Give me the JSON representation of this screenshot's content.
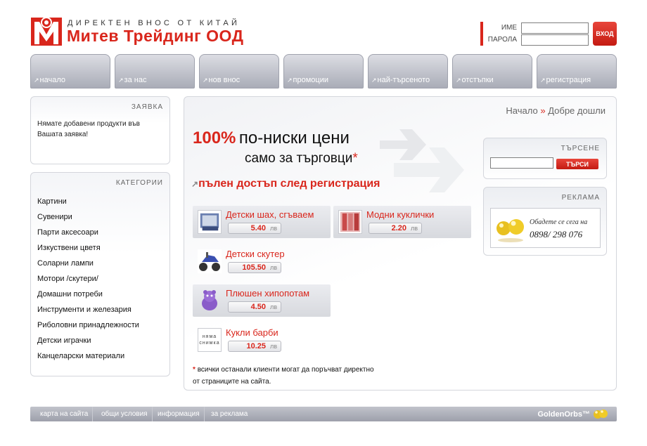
{
  "header": {
    "tagline": "ДИРЕКТЕН ВНОС ОТ КИТАЙ",
    "company": "Митев Трейдинг ООД"
  },
  "login": {
    "name_label": "ИМЕ",
    "password_label": "ПАРОЛА",
    "name_value": "",
    "password_value": "",
    "submit_label": "ВХОД"
  },
  "nav": {
    "items": [
      {
        "label": "начало"
      },
      {
        "label": "за нас"
      },
      {
        "label": "нов внос"
      },
      {
        "label": "промоции"
      },
      {
        "label": "най-търсеното"
      },
      {
        "label": "отстъпки"
      },
      {
        "label": "регистрация"
      }
    ]
  },
  "cart": {
    "title": "ЗАЯВКА",
    "text": "Нямате добавени продукти във Вашата заявка!"
  },
  "categories": {
    "title": "КАТЕГОРИИ",
    "items": [
      "Картини",
      "Сувенири",
      "Парти аксесоари",
      "Изкуствени цветя",
      "Соларни лампи",
      "Мотори /скутери/",
      "Домашни потреби",
      "Инструменти и железария",
      "Риболовни принадлежности",
      "Детски играчки",
      "Канцеларски материали"
    ]
  },
  "breadcrumb": {
    "home": "Начало",
    "separator": "»",
    "current": "Добре дошли"
  },
  "promo": {
    "percent": "100%",
    "line1": "по-ниски цени",
    "line2": "само за търговци",
    "star": "*",
    "access": "пълен достъп след регистрация"
  },
  "products": [
    {
      "name": "Детски шах, сгъваем",
      "price": "5.40",
      "currency": "лв"
    },
    {
      "name": "Модни куклички",
      "price": "2.20",
      "currency": "лв"
    },
    {
      "name": "Детски скутер",
      "price": "105.50",
      "currency": "лв"
    },
    {
      "name": "Плюшен хипопотам",
      "price": "4.50",
      "currency": "лв"
    },
    {
      "name": "Кукли барби",
      "price": "10.25",
      "currency": "лв",
      "thumb_text": "няма снимка"
    }
  ],
  "note": {
    "star": "*",
    "line1": "всички останали клиенти могат да поръчват директно",
    "line2": "от страниците на сайта."
  },
  "search": {
    "title": "ТЪРСЕНЕ",
    "value": "",
    "button": "ТЪРСИ"
  },
  "ad": {
    "title": "РЕКЛАМА",
    "line1": "Обадете се сега на",
    "line2": "0898/ 298 076"
  },
  "footer": {
    "links": [
      "карта на сайта",
      "общи условия",
      "информация",
      "за реклама"
    ],
    "brand": "GoldenOrbs™"
  },
  "colors": {
    "accent": "#d9261c",
    "nav_gray": "#a9acb7",
    "panel_border": "#d4d6dc"
  }
}
